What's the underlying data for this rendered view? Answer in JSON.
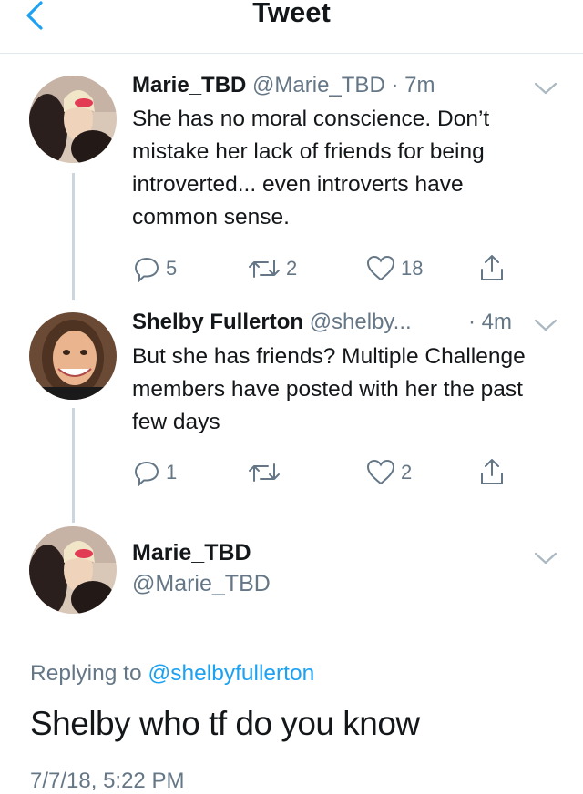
{
  "header": {
    "title": "Tweet",
    "back_icon": "chevron-left-icon"
  },
  "thread": [
    {
      "name": "Marie_TBD",
      "handle_time": "@Marie_TBD · 7m",
      "text": "She has no moral conscience. Don’t mistake her lack of friends for being introverted... even introverts have common sense.",
      "replies": "5",
      "retweets": "2",
      "likes": "18"
    },
    {
      "name": "Shelby Fullerton",
      "handle": "@shelby...",
      "time": "· 4m",
      "text": "But she has friends? Multiple Challenge members have posted with her the past few days",
      "replies": "1",
      "retweets": "",
      "likes": "2"
    }
  ],
  "main_tweet": {
    "name": "Marie_TBD",
    "handle": "@Marie_TBD",
    "replying_prefix": "Replying to ",
    "replying_to": "@shelbyfullerton",
    "text": "Shelby who tf do you know",
    "timestamp": "7/7/18, 5:22 PM"
  },
  "colors": {
    "accent": "#1da1f2",
    "muted": "#657786",
    "text": "#14171a",
    "border": "#e1e8ed"
  }
}
